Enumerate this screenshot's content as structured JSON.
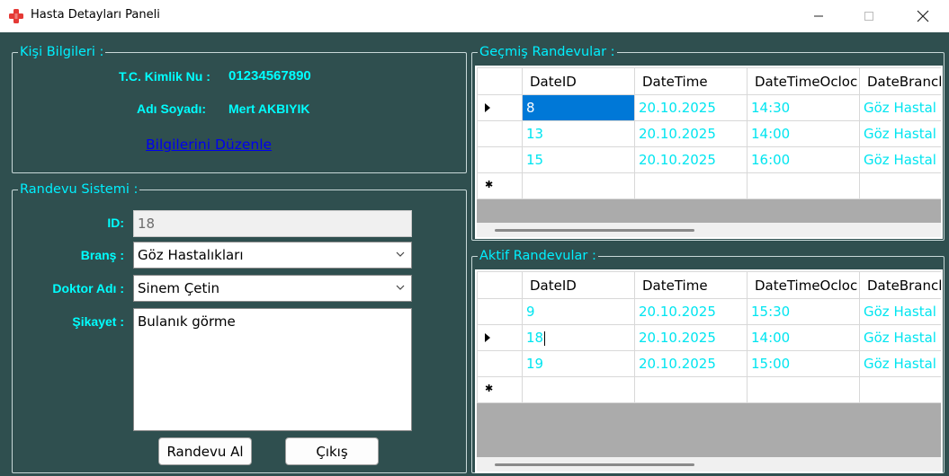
{
  "window": {
    "title": "Hasta Detayları Paneli",
    "icon": "red-cross-icon",
    "controls": [
      "minimize-icon",
      "maximize-icon",
      "close-icon"
    ]
  },
  "person": {
    "legend": "Kişi Bilgileri :",
    "tc_label": "T.C. Kimlik Nu :",
    "tc_value": "01234567890",
    "name_label": "Adı Soyadı:",
    "name_value": "Mert AKBIYIK",
    "edit_link": "Bilgilerini Düzenle"
  },
  "appointment": {
    "legend": "Randevu Sistemi :",
    "id_label": "ID:",
    "id_value": "18",
    "branch_label": "Branş :",
    "branch_value": "Göz Hastalıkları",
    "doctor_label": "Doktor Adı :",
    "doctor_value": "Sinem Çetin",
    "complaint_label": "Şikayet :",
    "complaint_value": "Bulanık görme",
    "submit_button": "Randevu Al",
    "exit_button": "Çıkış"
  },
  "past": {
    "legend": "Geçmiş Randevular :",
    "columns": [
      "DateID",
      "DateTime",
      "DateTimeOcloc",
      "DateBrancl"
    ],
    "rows": [
      [
        "8",
        "20.10.2025",
        "14:30",
        "Göz Hastal"
      ],
      [
        "13",
        "20.10.2025",
        "14:00",
        "Göz Hastal"
      ],
      [
        "15",
        "20.10.2025",
        "16:00",
        "Göz Hastal"
      ]
    ]
  },
  "active": {
    "legend": "Aktif Randevular :",
    "columns": [
      "DateID",
      "DateTime",
      "DateTimeOcloc",
      "DateBrancl"
    ],
    "rows": [
      [
        "9",
        "20.10.2025",
        "15:30",
        "Göz Hastal"
      ],
      [
        "18",
        "20.10.2025",
        "14:00",
        "Göz Hastal"
      ],
      [
        "19",
        "20.10.2025",
        "15:00",
        "Göz Hastal"
      ]
    ]
  },
  "colors": {
    "background": "#2f4f4f",
    "accent_text": "#00ffff",
    "selection": "#0078d7",
    "link": "#0000ee"
  }
}
